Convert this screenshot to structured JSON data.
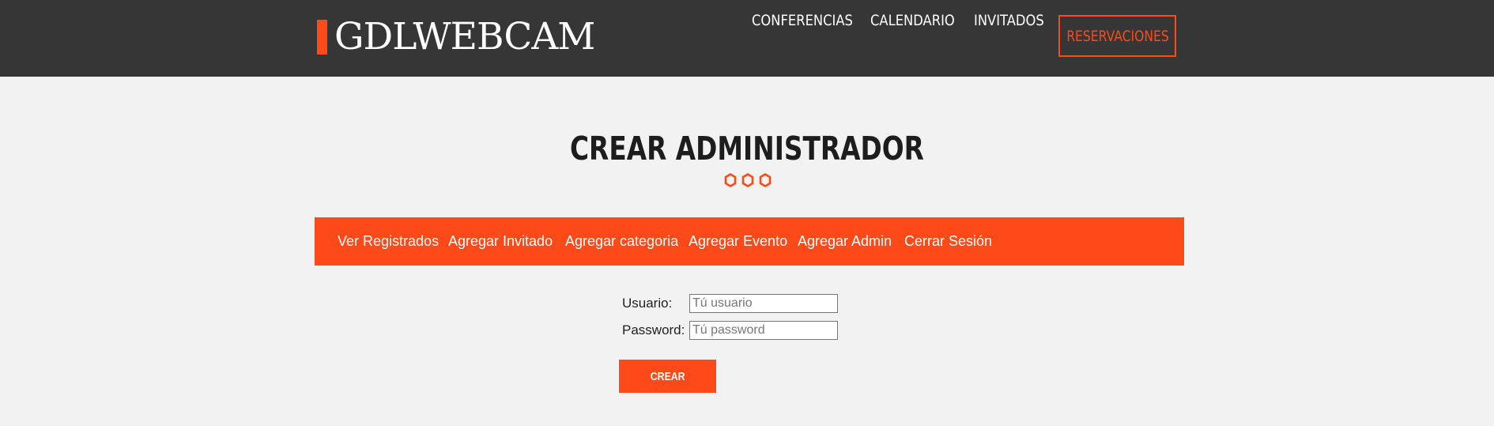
{
  "header": {
    "logo": "GDLWEBCAM",
    "nav": [
      "Conferencias",
      "Calendario",
      "Invitados"
    ],
    "cta": "Reservaciones"
  },
  "page": {
    "title": "CREAR ADMINISTRADOR"
  },
  "admin_menu": {
    "items": [
      "Ver Registrados",
      "Agregar Invitado",
      "Agregar categoria",
      "Agregar Evento",
      "Agregar Admin",
      "Cerrar Sesión"
    ]
  },
  "form": {
    "usuario_label": "Usuario:",
    "usuario_placeholder": "Tú usuario",
    "password_label": "Password:",
    "password_placeholder": "Tú password",
    "submit_label": "Crear"
  },
  "colors": {
    "accent": "#fe4918",
    "header_bg": "#363636",
    "page_bg": "#f2f2f2"
  },
  "icons": {
    "title_decoration": "hexagon-outline-icon"
  }
}
